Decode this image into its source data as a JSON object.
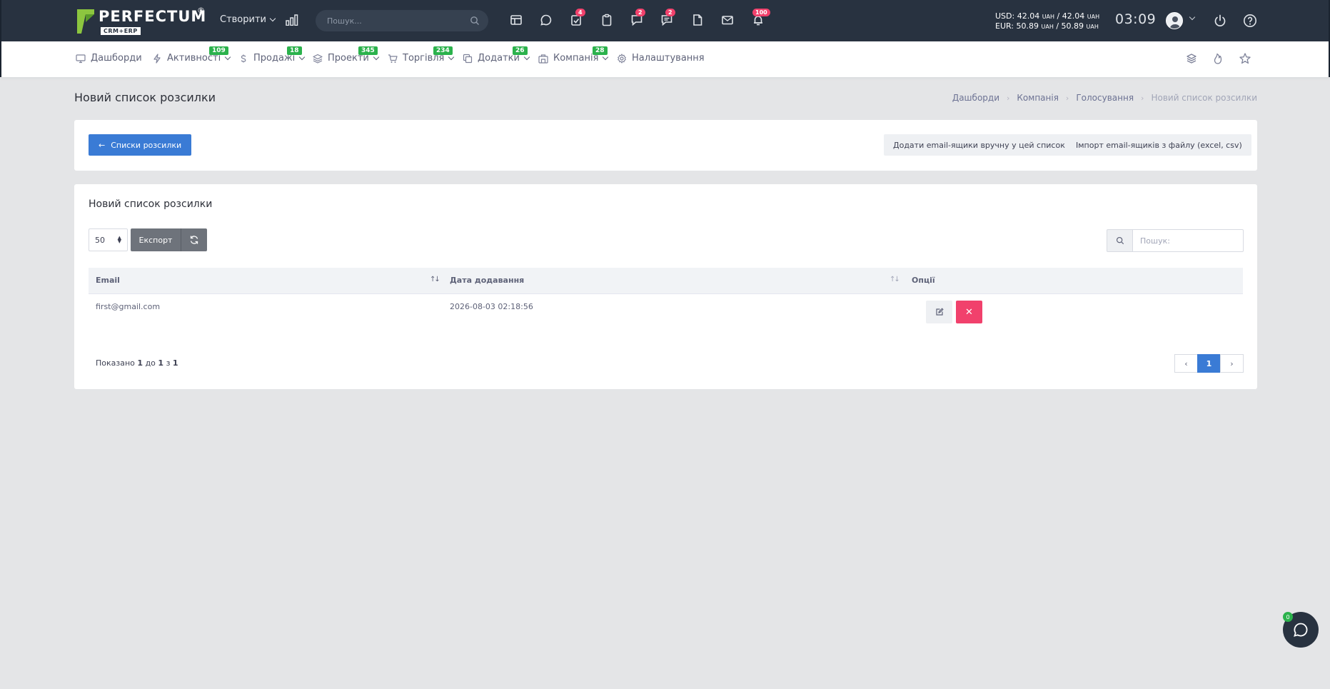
{
  "topbar": {
    "logo_text": "PERFECTUM",
    "logo_reg": "®",
    "logo_sub": "CRM+ERP",
    "create_label": "Створити",
    "search_placeholder": "Пошук...",
    "badges": {
      "tasks": "4",
      "comments": "2",
      "messages": "2",
      "notifications": "100"
    },
    "rates": {
      "usd_label": "USD: 42.04",
      "usd_cur1": "UAH",
      "usd_sep": "/ 42.04",
      "usd_cur2": "UAH",
      "eur_label": "EUR: 50.89",
      "eur_cur1": "UAH",
      "eur_sep": "/ 50.89",
      "eur_cur2": "UAH"
    },
    "clock": "03:09"
  },
  "nav": {
    "items": [
      {
        "label": "Дашборди",
        "icon": "monitor-icon"
      },
      {
        "label": "Активності",
        "badge": "109",
        "icon": "bolt-icon"
      },
      {
        "label": "Продажі",
        "badge": "18",
        "icon": "dollar-icon"
      },
      {
        "label": "Проекти",
        "badge": "345",
        "icon": "layers-icon"
      },
      {
        "label": "Торгівля",
        "badge": "234",
        "icon": "cart-icon"
      },
      {
        "label": "Додатки",
        "badge": "26",
        "icon": "copy-icon"
      },
      {
        "label": "Компанія",
        "badge": "28",
        "icon": "building-icon"
      },
      {
        "label": "Налаштування",
        "icon": "gear-icon"
      }
    ]
  },
  "page": {
    "title": "Новий список розсилки",
    "breadcrumb": [
      "Дашборди",
      "Компанія",
      "Голосування",
      "Новий список розсилки"
    ]
  },
  "actions": {
    "back_label": "Списки розсилки",
    "add_manual_label": "Додати email-ящики вручну у цей список",
    "import_label": "Імпорт email-ящиків з файлу (excel, csv)"
  },
  "table_card": {
    "title": "Новий список розсилки",
    "page_size": "50",
    "export_label": "Експорт",
    "search_placeholder": "Пошук:",
    "columns": [
      "Email",
      "Дата додавання",
      "Опції"
    ],
    "rows": [
      {
        "email": "first@gmail.com",
        "date": "2026-08-03 02:18:56"
      }
    ],
    "info_prefix": "Показано",
    "info_from": "1",
    "info_to_word": "до",
    "info_to": "1",
    "info_of_word": "з",
    "info_total": "1",
    "pager": {
      "prev": "‹",
      "current": "1",
      "next": "›"
    }
  },
  "chat": {
    "badge": "0"
  },
  "colors": {
    "topbar_bg": "#283240",
    "primary": "#3a7bd5",
    "danger": "#f1416c",
    "success": "#2bb24c"
  }
}
